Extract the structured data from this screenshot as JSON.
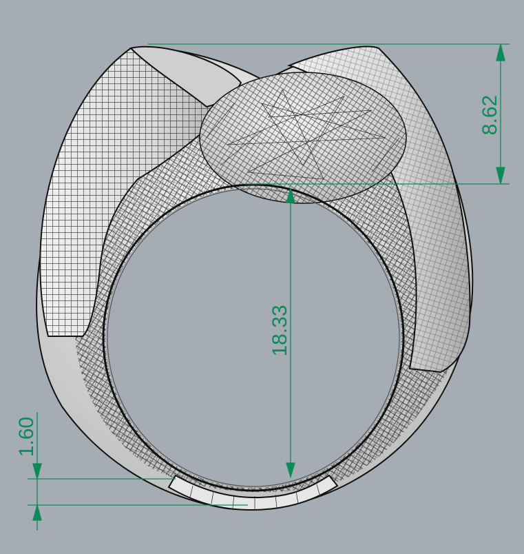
{
  "viewport": {
    "background": "#a5acb4",
    "dimension_color": "#0d8a5a",
    "model_fill": "#e4e4e4",
    "wire_color": "#1a1a1a"
  },
  "dimensions": {
    "top_height": "8.62",
    "inner_diameter": "18.33",
    "band_thickness": "1.60"
  }
}
